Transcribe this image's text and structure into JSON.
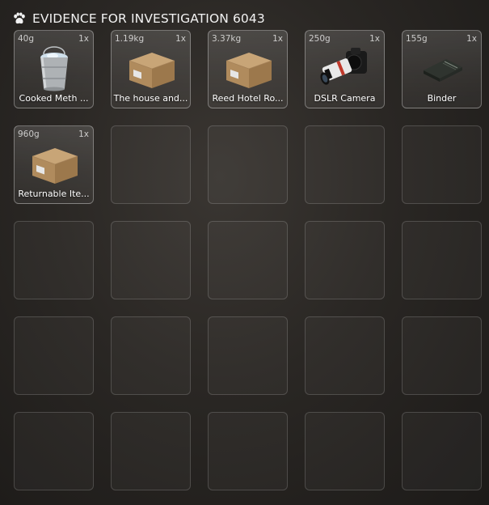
{
  "header": {
    "title": "EVIDENCE FOR INVESTIGATION 6043",
    "icon": "paw-icon"
  },
  "inventory": {
    "items": [
      {
        "label": "Cooked Meth ...",
        "weight": "40g",
        "quantity": "1x",
        "icon": "bucket-icon"
      },
      {
        "label": "The house and...",
        "weight": "1.19kg",
        "quantity": "1x",
        "icon": "evidence-box-icon"
      },
      {
        "label": "Reed Hotel Ro...",
        "weight": "3.37kg",
        "quantity": "1x",
        "icon": "evidence-box-icon"
      },
      {
        "label": "DSLR Camera",
        "weight": "250g",
        "quantity": "1x",
        "icon": "camera-icon"
      },
      {
        "label": "Binder",
        "weight": "155g",
        "quantity": "1x",
        "icon": "binder-icon"
      },
      {
        "label": "Returnable Ite...",
        "weight": "960g",
        "quantity": "1x",
        "icon": "evidence-box-icon"
      }
    ],
    "total_slots": 25
  }
}
